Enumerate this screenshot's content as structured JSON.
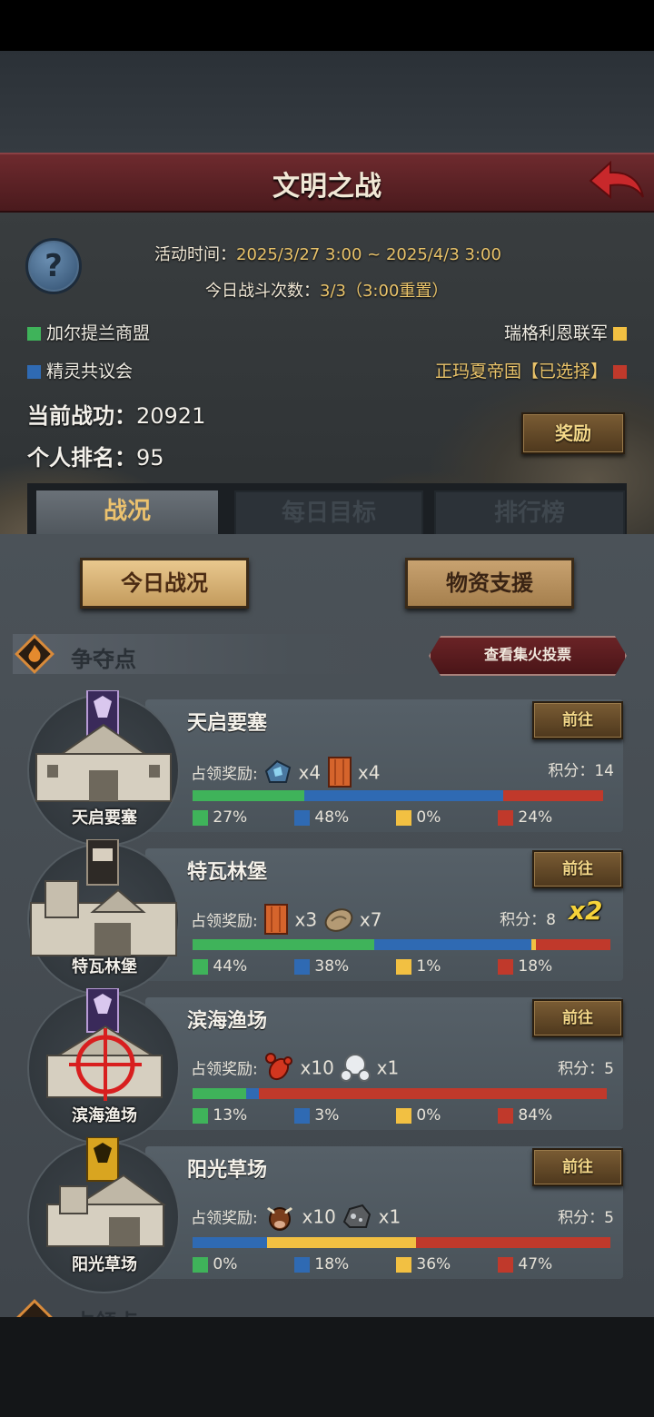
{
  "title": "文明之战",
  "activity_time_label": "活动时间：",
  "activity_time_value": "2025/3/27 3:00 ~ 2025/4/3 3:00",
  "battles_label": "今日战斗次数：",
  "battles_value": "3/3（",
  "battles_reset": "3:00重置",
  "battles_close": "）",
  "factions": [
    {
      "name": "加尔提兰商盟",
      "color": "#3fb35a"
    },
    {
      "name": "精灵共议会",
      "color": "#2f6ab3"
    },
    {
      "name": "瑞格利恩联军",
      "color": "#f2c042"
    },
    {
      "name": "正玛夏帝国【已选择】",
      "color": "#c0392b"
    }
  ],
  "merit_label": "当前战功：",
  "merit_value": "20921",
  "rank_label": "个人排名：",
  "rank_value": "95",
  "reward_button": "奖励",
  "tabs": [
    "战况",
    "每日目标",
    "排行榜"
  ],
  "sub_buttons": [
    "今日战况",
    "物资支援"
  ],
  "section_title": "争夺点",
  "vote_button": "查看集火投票",
  "goto_label": "前往",
  "reward_label": "占领奖励:",
  "score_label": "积分：",
  "cards": [
    {
      "name": "天启要塞",
      "castle_label": "天启要塞",
      "rewards": [
        {
          "icon": "crystal-icon",
          "qty": "x4"
        },
        {
          "icon": "wood-plank-icon",
          "qty": "x4"
        }
      ],
      "score": "14",
      "multiplier": "",
      "shares": [
        27,
        48,
        0,
        24
      ],
      "pcts": [
        "27%",
        "48%",
        "0%",
        "24%"
      ],
      "banner": "purple"
    },
    {
      "name": "特瓦林堡",
      "castle_label": "特瓦林堡",
      "rewards": [
        {
          "icon": "wood-plank-icon",
          "qty": "x3"
        },
        {
          "icon": "stone-icon",
          "qty": "x7"
        }
      ],
      "score": "8",
      "multiplier": "x2",
      "shares": [
        44,
        38,
        1,
        18
      ],
      "pcts": [
        "44%",
        "38%",
        "1%",
        "18%"
      ],
      "banner": "dark"
    },
    {
      "name": "滨海渔场",
      "castle_label": "滨海渔场",
      "rewards": [
        {
          "icon": "lobster-icon",
          "qty": "x10"
        },
        {
          "icon": "pearl-icon",
          "qty": "x1"
        }
      ],
      "score": "5",
      "multiplier": "",
      "shares": [
        13,
        3,
        0,
        84
      ],
      "pcts": [
        "13%",
        "3%",
        "0%",
        "84%"
      ],
      "banner": "purple"
    },
    {
      "name": "阳光草场",
      "castle_label": "阳光草场",
      "rewards": [
        {
          "icon": "cow-icon",
          "qty": "x10"
        },
        {
          "icon": "ore-icon",
          "qty": "x1"
        }
      ],
      "score": "5",
      "multiplier": "",
      "shares": [
        0,
        18,
        36,
        47
      ],
      "pcts": [
        "0%",
        "18%",
        "36%",
        "47%"
      ],
      "banner": "gold"
    }
  ],
  "next_section_title": "占领点",
  "colors": {
    "green": "#3fb35a",
    "blue": "#2f6ab3",
    "yellow": "#f2c042",
    "red": "#c0392b"
  }
}
